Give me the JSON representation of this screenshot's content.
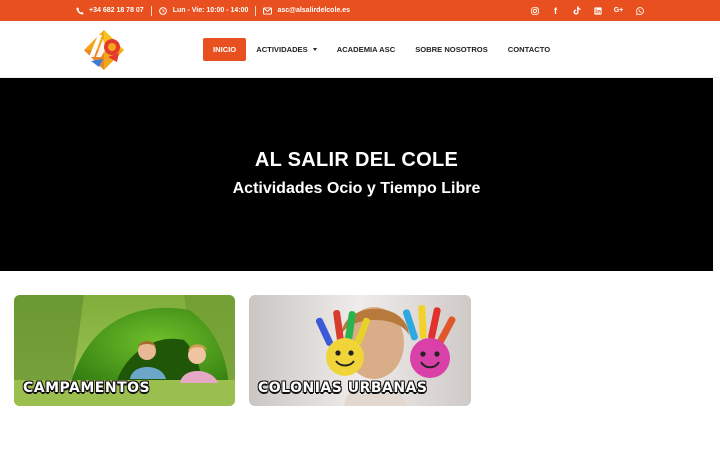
{
  "colors": {
    "brand": "#e8511f",
    "hero_bg": "#000000"
  },
  "topbar": {
    "phone": "+34 682 18 78 07",
    "hours": "Lun - Vie: 10:00 - 14:00",
    "email": "asc@alsalirdelcole.es",
    "phone_icon": "phone-icon",
    "hours_icon": "clock-icon",
    "email_icon": "envelope-icon",
    "social": [
      "instagram-icon",
      "facebook-icon",
      "tiktok-icon",
      "linkedin-icon",
      "google-plus-icon",
      "whatsapp-icon"
    ],
    "social_glyphs": {
      "facebook": "f",
      "google": "G+"
    }
  },
  "nav": {
    "items": [
      {
        "label": "INICIO",
        "active": true
      },
      {
        "label": "ACTIVIDADES",
        "dropdown": true
      },
      {
        "label": "ACADEMIA ASC"
      },
      {
        "label": "SOBRE NOSOTROS"
      },
      {
        "label": "CONTACTO"
      }
    ]
  },
  "hero": {
    "title": "AL SALIR DEL COLE",
    "subtitle": "Actividades Ocio y Tiempo Libre"
  },
  "cards": [
    {
      "label": "CAMPAMENTOS"
    },
    {
      "label": "COLONIAS URBANAS"
    }
  ]
}
